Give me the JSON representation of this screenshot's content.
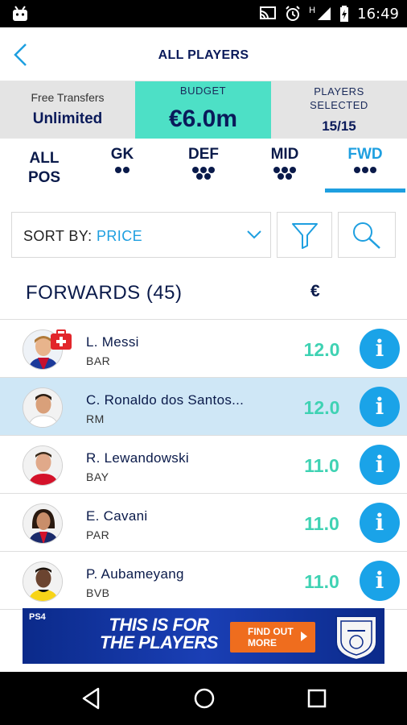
{
  "statusbar": {
    "time": "16:49",
    "network": "H"
  },
  "header": {
    "title": "ALL PLAYERS",
    "back_icon": "chevron-left-icon"
  },
  "info": {
    "free_transfers_label": "Free Transfers",
    "free_transfers_value": "Unlimited",
    "budget_label": "BUDGET",
    "budget_value": "€6.0m",
    "players_selected_label": "PLAYERS SELECTED",
    "players_selected_value": "15/15"
  },
  "tabs": [
    {
      "label": "ALL POS",
      "dots": 0
    },
    {
      "label": "GK",
      "dots": 2
    },
    {
      "label": "DEF",
      "dots": 5
    },
    {
      "label": "MID",
      "dots": 5
    },
    {
      "label": "FWD",
      "dots": 3,
      "active": true
    }
  ],
  "sort": {
    "prefix": "SORT BY:",
    "value": "PRICE"
  },
  "list": {
    "title": "FORWARDS (45)",
    "currency": "€",
    "players": [
      {
        "name": "L. Messi",
        "team": "BAR",
        "price": "12.0",
        "injured": true
      },
      {
        "name": "C. Ronaldo dos Santos...",
        "team": "RM",
        "price": "12.0",
        "selected": true
      },
      {
        "name": "R. Lewandowski",
        "team": "BAY",
        "price": "11.0"
      },
      {
        "name": "E. Cavani",
        "team": "PAR",
        "price": "11.0"
      },
      {
        "name": "P. Aubameyang",
        "team": "BVB",
        "price": "11.0"
      }
    ]
  },
  "ad": {
    "brand": "PS4",
    "slogan_line1": "THIS IS FOR",
    "slogan_line2": "THE PLAYERS",
    "cta_line1": "FIND OUT",
    "cta_line2": "MORE"
  },
  "colors": {
    "accent": "#1e9fe0",
    "budget_bg": "#4de0c6",
    "price": "#3fd2b3",
    "navy": "#0a1a4a",
    "selected_row": "#cfe7f6"
  }
}
